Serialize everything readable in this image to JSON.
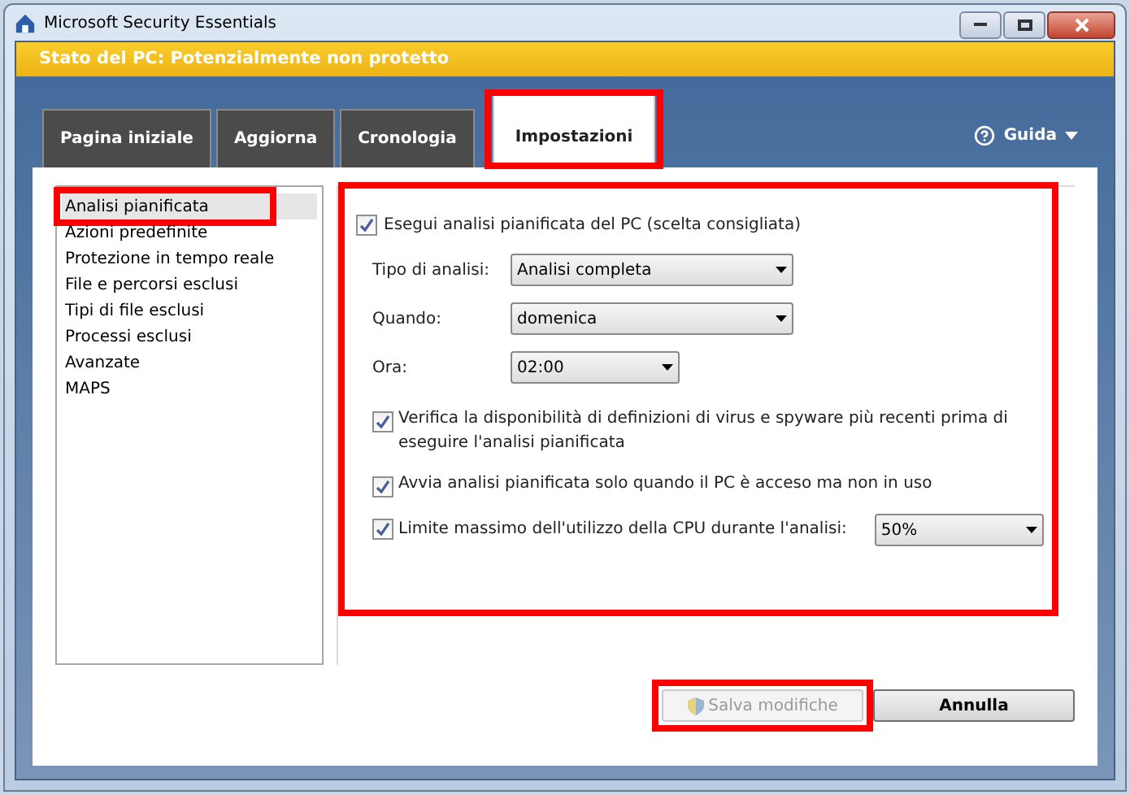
{
  "window": {
    "title": "Microsoft Security Essentials"
  },
  "status_bar": {
    "text": "Stato del PC: Potenzialmente non protetto"
  },
  "tabs": [
    {
      "label": "Pagina iniziale",
      "selected": false
    },
    {
      "label": "Aggiorna",
      "selected": false
    },
    {
      "label": "Cronologia",
      "selected": false
    },
    {
      "label": "Impostazioni",
      "selected": true
    }
  ],
  "help": {
    "label": "Guida"
  },
  "sidebar": {
    "items": [
      {
        "label": "Analisi pianificata",
        "selected": true
      },
      {
        "label": "Azioni predefinite",
        "selected": false
      },
      {
        "label": "Protezione in tempo reale",
        "selected": false
      },
      {
        "label": "File e percorsi esclusi",
        "selected": false
      },
      {
        "label": "Tipi di file esclusi",
        "selected": false
      },
      {
        "label": "Processi esclusi",
        "selected": false
      },
      {
        "label": "Avanzate",
        "selected": false
      },
      {
        "label": "MAPS",
        "selected": false
      }
    ]
  },
  "settings": {
    "run_scan": {
      "label": "Esegui analisi pianificata del PC (scelta consigliata)",
      "checked": true
    },
    "fields": [
      {
        "label": "Tipo di analisi:",
        "value": "Analisi completa"
      },
      {
        "label": "Quando:",
        "value": "domenica"
      },
      {
        "label": "Ora:",
        "value": "02:00"
      }
    ],
    "options": [
      {
        "label": "Verifica la disponibilità di definizioni di virus e spyware più recenti prima di eseguire l'analisi pianificata",
        "checked": true
      },
      {
        "label": "Avvia analisi pianificata solo quando il PC è acceso ma non in uso",
        "checked": true
      },
      {
        "label": "Limite massimo dell'utilizzo della CPU durante l'analisi:",
        "checked": true,
        "value": "50%"
      }
    ]
  },
  "buttons": [
    {
      "label": "Salva modifiche",
      "disabled": true
    },
    {
      "label": "Annulla",
      "disabled": false
    }
  ]
}
